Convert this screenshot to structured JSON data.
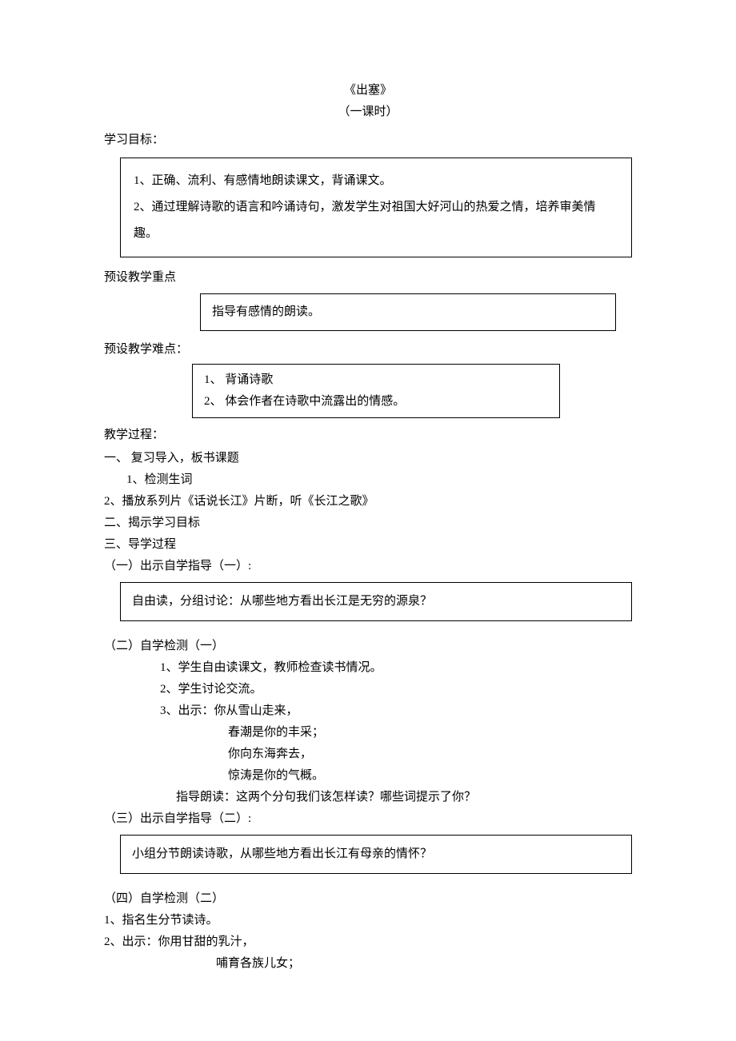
{
  "title": "《出塞》",
  "subtitle": "（一课时）",
  "headings": {
    "objectives": "学习目标：",
    "keypoint": "预设教学重点",
    "difficulty": "预设教学难点：",
    "process": "教学过程："
  },
  "objectives": {
    "item1": "1、正确、流利、有感情地朗读课文，背诵课文。",
    "item2": "2、通过理解诗歌的语言和吟诵诗句，激发学生对祖国大好河山的热爱之情，培养审美情趣。"
  },
  "keypoint_box": "指导有感情的朗读。",
  "difficulty_box": {
    "item1": "1、 背诵诗歌",
    "item2": "2、 体会作者在诗歌中流露出的情感。"
  },
  "process": {
    "p1": "一、 复习导入，板书课题",
    "p1_1": "1、检测生词",
    "p1_2": "2、播放系列片《话说长江》片断，听《长江之歌》",
    "p2": "二、揭示学习目标",
    "p3": "三、导学过程",
    "p3_1_label": "（一）出示自学指导（一）:",
    "p3_1_box": "自由读，分组讨论：从哪些地方看出长江是无穷的源泉？",
    "p3_2_label": "（二）自学检测（一）",
    "p3_2_1": "1、学生自由读课文，教师检查读书情况。",
    "p3_2_2": "2、学生讨论交流。",
    "p3_2_3": "3、出示：你从雪山走来，",
    "p3_2_3b": "春潮是你的丰采；",
    "p3_2_3c": "你向东海奔去，",
    "p3_2_3d": "惊涛是你的气概。",
    "p3_2_3e": "指导朗读：这两个分句我们该怎样读？哪些词提示了你？",
    "p3_3_label": "（三）出示自学指导（二）:",
    "p3_3_box": "小组分节朗读诗歌，从哪些地方看出长江有母亲的情怀？",
    "p3_4_label": "（四）自学检测（二）",
    "p3_4_1": "1、指名生分节读诗。",
    "p3_4_2": "2、出示：你用甘甜的乳汁，",
    "p3_4_2b": "哺育各族儿女；"
  }
}
